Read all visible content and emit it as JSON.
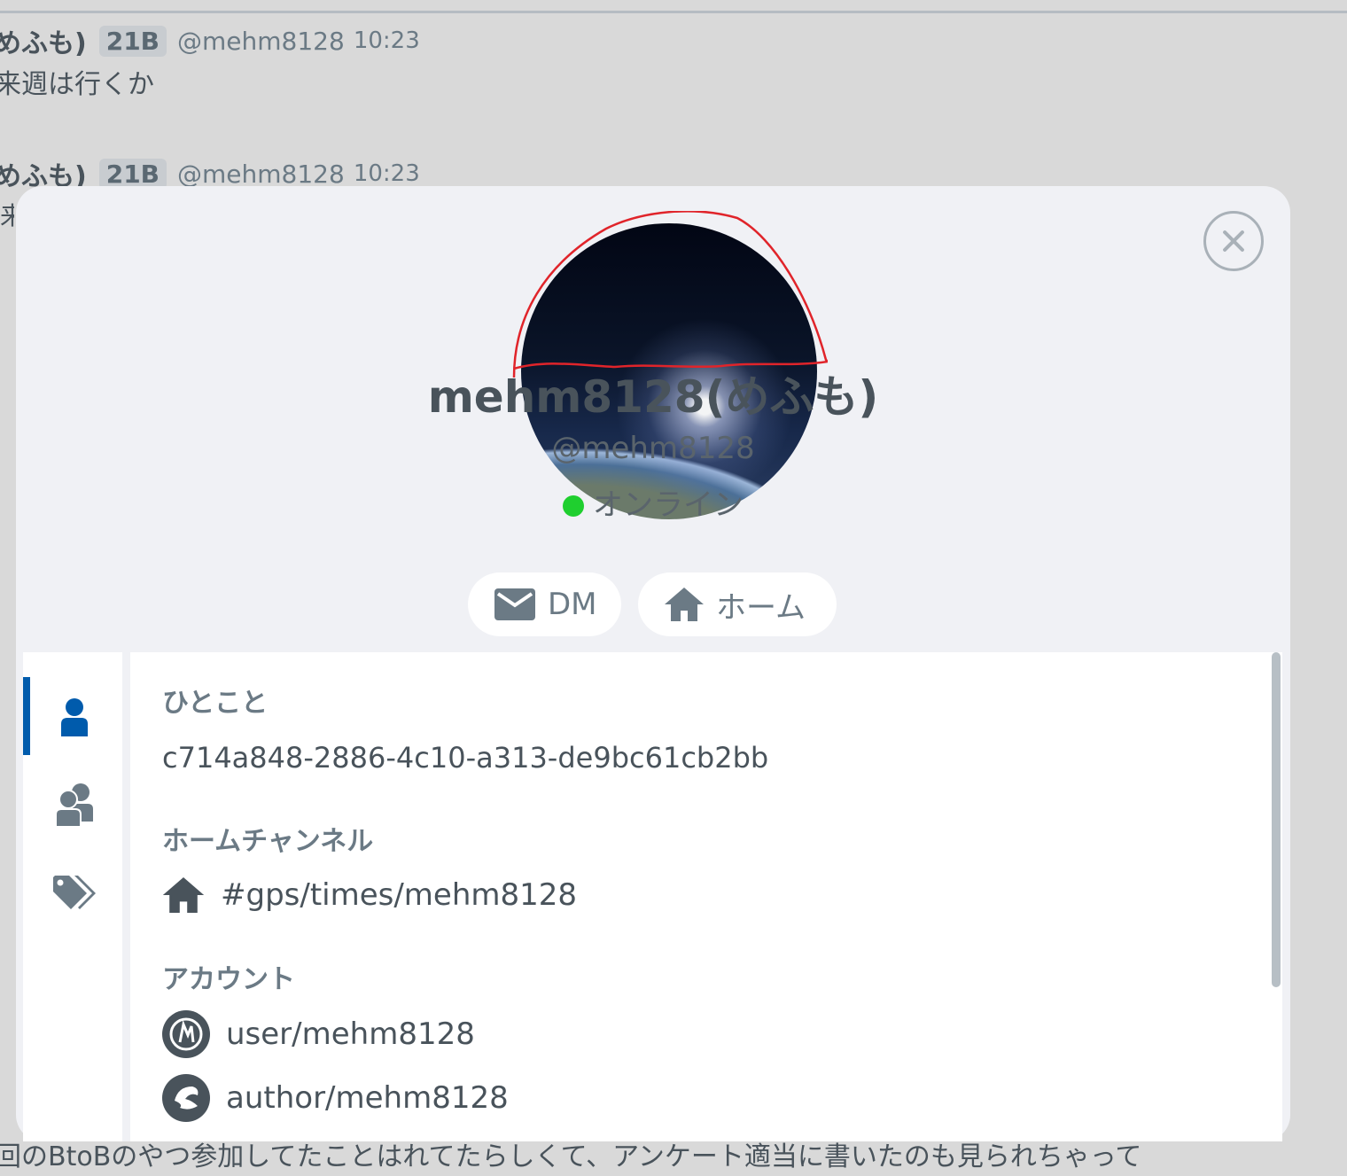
{
  "chat": {
    "messages": [
      {
        "nick": "めふも)",
        "grade": "21B",
        "handle": "@mehm8128",
        "time": "10:23",
        "text": "来週は行くか"
      },
      {
        "nick": "めふも)",
        "grade": "21B",
        "handle": "@mehm8128",
        "time": "10:23",
        "text": "来"
      }
    ],
    "bottom_text": "回のBtoBのやつ参加してたことはれてたらしくて、アンケート適当に書いたのも見られちゃって"
  },
  "profile": {
    "display_name": "mehm8128(めふも)",
    "handle": "@mehm8128",
    "status": "オンライン",
    "status_color": "#1fcf2f",
    "dm_label": "DM",
    "home_label": "ホーム",
    "sections": {
      "bio_title": "ひとこと",
      "bio": "c714a848-2886-4c10-a313-de9bc61cb2bb",
      "home_channel_title": "ホームチャンネル",
      "home_channel": "#gps/times/mehm8128",
      "accounts_title": "アカウント",
      "accounts": [
        "user/mehm8128",
        "author/mehm8128"
      ]
    },
    "tabs": [
      {
        "icon": "person-icon",
        "active": true
      },
      {
        "icon": "group-icon",
        "active": false
      },
      {
        "icon": "tags-icon",
        "active": false
      }
    ],
    "accent_color": "#005bac"
  }
}
